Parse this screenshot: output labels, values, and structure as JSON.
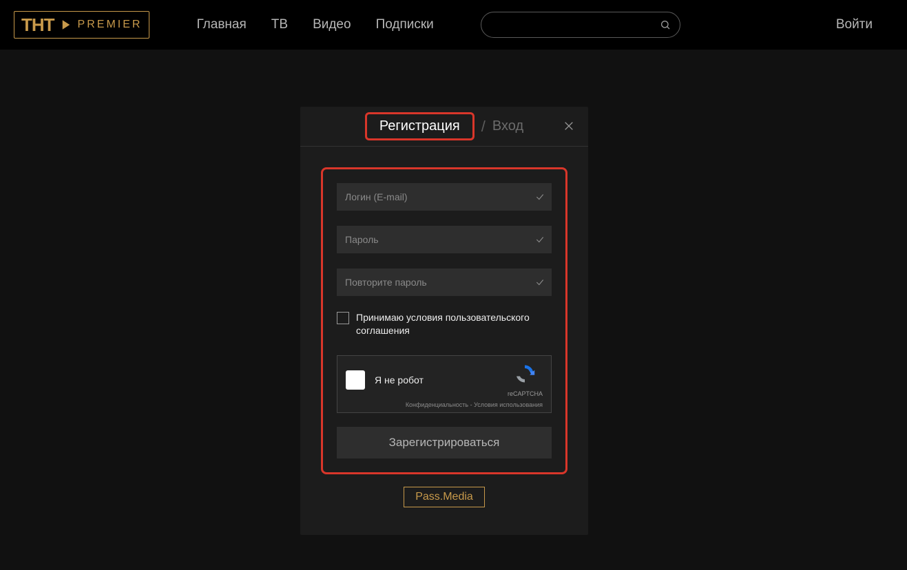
{
  "header": {
    "logo_tht": "ТНТ",
    "logo_premier": "PREMIER",
    "nav": [
      {
        "label": "Главная"
      },
      {
        "label": "ТВ"
      },
      {
        "label": "Видео"
      },
      {
        "label": "Подписки"
      }
    ],
    "search_placeholder": "",
    "login": "Войти"
  },
  "modal": {
    "tab_register": "Регистрация",
    "tab_separator": "/",
    "tab_login": "Вход",
    "fields": {
      "email_placeholder": "Логин (E-mail)",
      "password_placeholder": "Пароль",
      "password_repeat_placeholder": "Повторите пароль"
    },
    "terms_label": "Принимаю условия пользовательского соглашения",
    "captcha": {
      "label": "Я не робот",
      "brand": "reCAPTCHA",
      "footer": "Конфиденциальность - Условия использования"
    },
    "submit": "Зарегистрироваться",
    "pass_media": "Pass.Media"
  }
}
